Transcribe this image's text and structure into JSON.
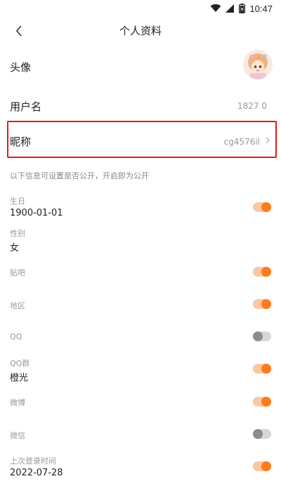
{
  "status_bar": {
    "time": "10:47"
  },
  "header": {
    "title": "个人资料"
  },
  "rows": {
    "avatar_label": "头像",
    "username_label": "用户名",
    "username_value": "1827 0",
    "nickname_label": "昵称",
    "nickname_value": "cg4576il"
  },
  "hint": "以下信息可设置是否公开，开启即为公开",
  "fields": [
    {
      "label": "生日",
      "value": "1900-01-01",
      "toggle": "on"
    },
    {
      "label": "性别",
      "value": "女"
    },
    {
      "label": "贴吧",
      "toggle": "on"
    },
    {
      "label": "地区",
      "toggle": "on"
    },
    {
      "label": "QQ",
      "toggle": "off"
    },
    {
      "label": "QQ群",
      "value": "橙光",
      "toggle": "on"
    },
    {
      "label": "微博",
      "toggle": "on"
    },
    {
      "label": "微信",
      "toggle": "off"
    },
    {
      "label": "上次登录时间",
      "value": "2022-07-28",
      "toggle": "on"
    }
  ],
  "colors": {
    "accent": "#ff7a1a",
    "highlight_border": "#e01c1c"
  }
}
